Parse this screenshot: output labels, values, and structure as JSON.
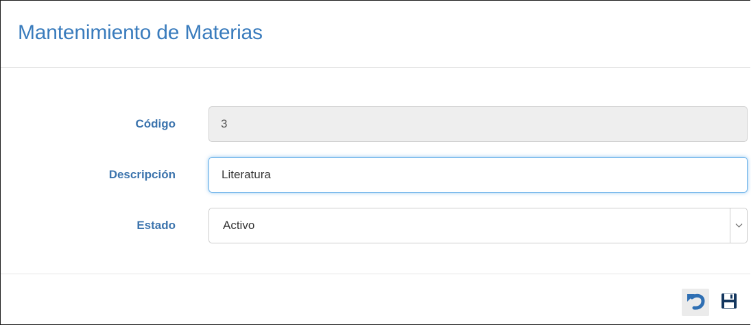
{
  "page": {
    "title": "Mantenimiento de Materias"
  },
  "form": {
    "codigo": {
      "label": "Código",
      "value": "3"
    },
    "descripcion": {
      "label": "Descripción",
      "value": "Literatura"
    },
    "estado": {
      "label": "Estado",
      "selected": "Activo"
    }
  },
  "footer": {
    "undo_icon": "undo-icon",
    "save_icon": "save-icon"
  },
  "colors": {
    "title": "#3a7cbd",
    "label": "#3c74ad",
    "icon": "#2f6fb3",
    "focus_border": "#66afe9"
  }
}
